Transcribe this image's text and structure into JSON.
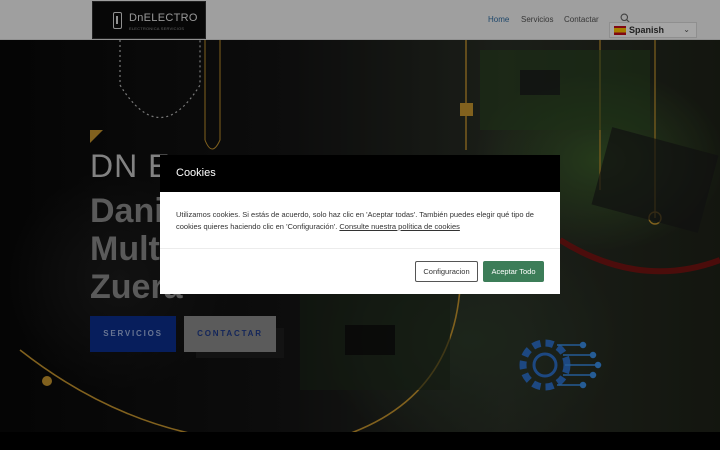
{
  "header": {
    "logo_title": "DnELECTRO",
    "logo_subtitle": "ELECTRONICA SERVICIOS",
    "nav": [
      {
        "label": "Home",
        "active": true
      },
      {
        "label": "Servicios",
        "active": false
      },
      {
        "label": "Contactar",
        "active": false
      }
    ],
    "language": {
      "selected": "Spanish"
    }
  },
  "hero": {
    "subtitle": "DN E",
    "title_lines": [
      "Dani",
      "Mult",
      "Zuera"
    ],
    "buttons": {
      "servicios": "SERVICIOS",
      "contactar": "CONTACTAR"
    }
  },
  "cookies": {
    "title": "Cookies",
    "text": "Utilizamos cookies. Si estás de acuerdo, solo haz clic en 'Aceptar todas'. También puedes elegir qué tipo de cookies quieres haciendo clic en 'Configuración'.",
    "link": "Consulte nuestra política de cookies",
    "config_button": "Configuracion",
    "accept_button": "Aceptar Todo"
  },
  "colors": {
    "accent_blue": "#2e6da4",
    "servicios_button": "#0b2f8e",
    "accept_green": "#3c7d58",
    "gold": "#c7962e"
  },
  "icons": [
    "phone-icon",
    "search-icon",
    "spain-flag-icon",
    "chevron-down-icon",
    "gear-circuit-icon"
  ]
}
